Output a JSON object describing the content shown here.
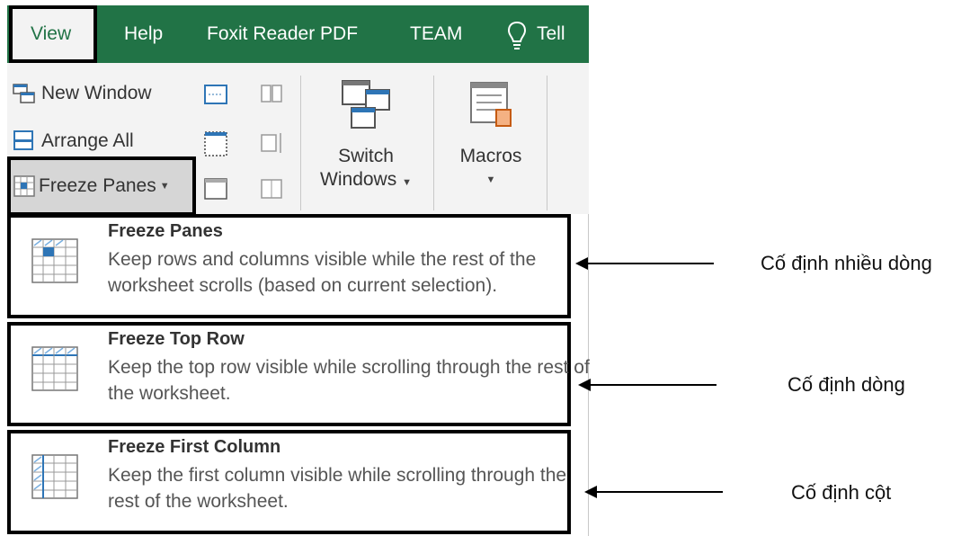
{
  "tabs": {
    "view": "View",
    "help": "Help",
    "foxit": "Foxit Reader PDF",
    "team": "TEAM",
    "tell": "Tell"
  },
  "ribbon": {
    "new_window": "New Window",
    "arrange_all": "Arrange All",
    "freeze_panes": "Freeze Panes",
    "switch_windows_line1": "Switch",
    "switch_windows_line2": "Windows",
    "macros": "Macros"
  },
  "menu": {
    "items": [
      {
        "title": "Freeze Panes",
        "desc": "Keep rows and columns visible while the rest of the worksheet scrolls (based on current selection)."
      },
      {
        "title": "Freeze Top Row",
        "desc": "Keep the top row visible while scrolling through the rest of the worksheet."
      },
      {
        "title": "Freeze First Column",
        "desc": "Keep the first column visible while scrolling through the rest of the worksheet."
      }
    ]
  },
  "annotations": {
    "freeze_panes": "Cố định nhiều dòng",
    "freeze_top_row": "Cố định dòng",
    "freeze_first_column": "Cố định cột"
  },
  "colors": {
    "excel_green": "#217346",
    "ribbon_bg": "#f3f3f3"
  }
}
